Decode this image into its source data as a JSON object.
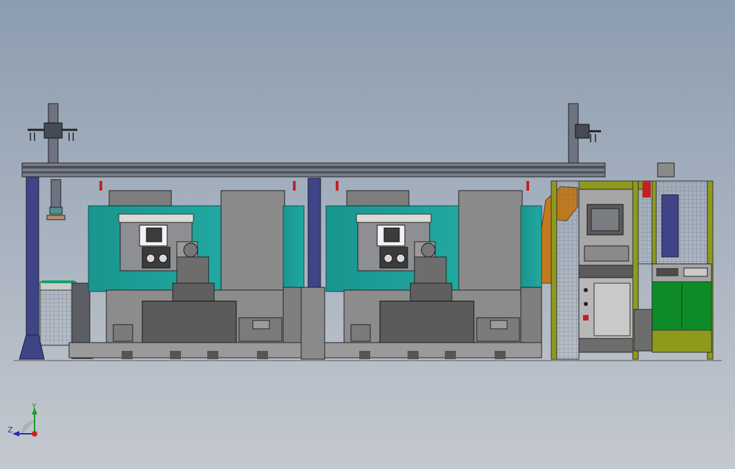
{
  "viewport": {
    "background_top": "#8c9db0",
    "background_bottom": "#c4c8cf"
  },
  "colors": {
    "teal": "#1b9c96",
    "gray": "#8a8a8a",
    "dark_gray": "#5f5f5f",
    "navy": "#3f4486",
    "olive": "#8f9a1d",
    "green": "#0f8c2a",
    "orange": "#c27a1c"
  },
  "triad": {
    "x_label": "",
    "y_label": "Y",
    "z_label": "Z",
    "y_color": "#1c9a23",
    "z_color": "#1f2db0",
    "origin_color": "#d22020"
  }
}
